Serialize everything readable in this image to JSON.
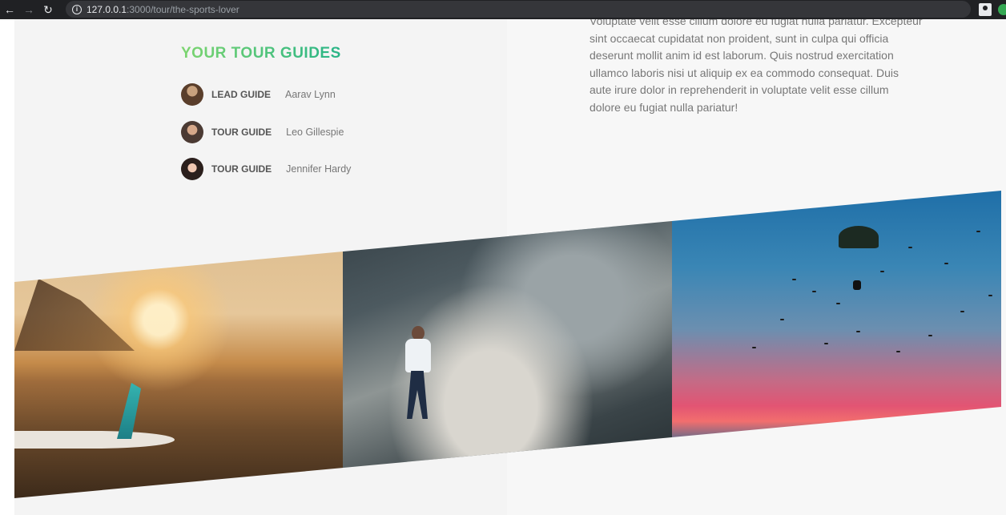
{
  "browser": {
    "url_host": "127.0.0.1",
    "url_path": ":3000/tour/the-sports-lover",
    "back_icon": "arrow-left-icon",
    "forward_icon": "arrow-right-icon",
    "reload_icon": "reload-icon",
    "info_icon": "info-icon"
  },
  "guides": {
    "title": "YOUR TOUR GUIDES",
    "items": [
      {
        "role": "LEAD GUIDE",
        "name": "Aarav Lynn"
      },
      {
        "role": "TOUR GUIDE",
        "name": "Leo Gillespie"
      },
      {
        "role": "TOUR GUIDE",
        "name": "Jennifer Hardy"
      }
    ]
  },
  "description": {
    "text": "Voluptate velit esse cillum dolore eu fugiat nulla pariatur. Excepteur sint occaecat cupidatat non proident, sunt in culpa qui officia deserunt mollit anim id est laborum. Quis nostrud exercitation ullamco laboris nisi ut aliquip ex ea commodo consequat. Duis aute irure dolor in reprehenderit in voluptate velit esse cillum dolore eu fugiat nulla pariatur!"
  },
  "colors": {
    "accent_start": "#7dd56f",
    "accent_end": "#28b487"
  }
}
